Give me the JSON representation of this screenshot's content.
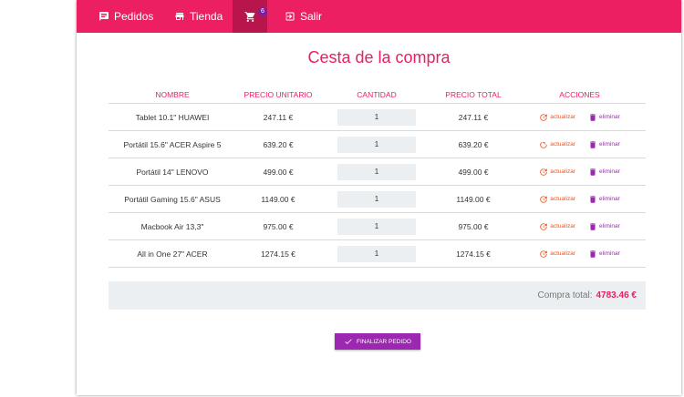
{
  "nav": {
    "orders_label": "Pedidos",
    "store_label": "Tienda",
    "cart_count": "6",
    "logout_label": "Salir"
  },
  "page": {
    "title": "Cesta de la compra"
  },
  "table": {
    "headers": [
      "NOMBRE",
      "PRECIO UNITARIO",
      "CANTIDAD",
      "PRECIO TOTAL",
      "ACCIONES"
    ],
    "update_label": "actualizar",
    "delete_label": "eliminar",
    "rows": [
      {
        "name": "Tablet 10.1\" HUAWEI",
        "unit_price": "247.11 €",
        "quantity": "1",
        "total_price": "247.11 €"
      },
      {
        "name": "Portátil 15.6\" ACER Aspire 5",
        "unit_price": "639.20 €",
        "quantity": "1",
        "total_price": "639.20 €"
      },
      {
        "name": "Portátil 14\" LENOVO",
        "unit_price": "499.00 €",
        "quantity": "1",
        "total_price": "499.00 €"
      },
      {
        "name": "Portátil Gaming 15.6\" ASUS",
        "unit_price": "1149.00 €",
        "quantity": "1",
        "total_price": "1149.00 €"
      },
      {
        "name": "Macbook Air 13,3\"",
        "unit_price": "975.00 €",
        "quantity": "1",
        "total_price": "975.00 €"
      },
      {
        "name": "All in One 27\" ACER",
        "unit_price": "1274.15 €",
        "quantity": "1",
        "total_price": "1274.15 €"
      }
    ]
  },
  "summary": {
    "label": "Compra total:",
    "amount": "4783.46 €"
  },
  "checkout": {
    "button_label": "FINALIZAR PEDIDO"
  },
  "colors": {
    "primary": "#ec1f62",
    "accent": "#9c27b0",
    "update": "#f4511e"
  }
}
